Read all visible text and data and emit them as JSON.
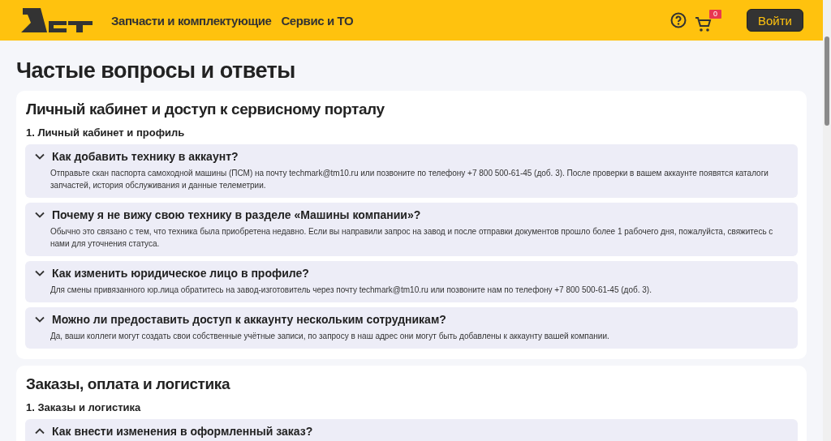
{
  "header": {
    "nav": [
      {
        "label": "Запчасти и комплектующие"
      },
      {
        "label": "Сервис и ТО"
      }
    ],
    "cart_count": "0",
    "login_button": "Войти"
  },
  "title": "Частые вопросы и ответы",
  "sections": [
    {
      "title": "Личный кабинет и доступ к сервисному порталу",
      "subtitle": "1. Личный кабинет и профиль",
      "items": [
        {
          "question": "Как добавить технику в аккаунт?",
          "expanded": true,
          "answer": "Отправьте скан паспорта самоходной машины (ПСМ) на почту techmark@tm10.ru или позвоните по телефону +7 800 500-61-45 (доб. 3). После проверки в вашем аккаунте появятся каталоги запчастей, история обслуживания и данные телеметрии."
        },
        {
          "question": "Почему я не вижу свою технику в разделе «Машины компании»?",
          "expanded": true,
          "answer": "Обычно это связано с тем, что техника была приобретена недавно. Если вы направили запрос на завод и после отправки документов прошло более 1 рабочего дня, пожалуйста, свяжитесь с нами для уточнения статуса."
        },
        {
          "question": "Как изменить юридическое лицо в профиле?",
          "expanded": true,
          "answer": "Для смены привязанного юр.лица обратитесь на завод-изготовитель через почту techmark@tm10.ru или позвоните нам по телефону +7 800 500-61-45 (доб. 3)."
        },
        {
          "question": "Можно ли предоставить доступ к аккаунту нескольким сотрудникам?",
          "expanded": true,
          "answer": "Да, ваши коллеги могут создать свои собственные учётные записи, по запросу в наш адрес они могут быть добавлены к аккаунту вашей компании."
        }
      ]
    },
    {
      "title": "Заказы, оплата и логистика",
      "subtitle": "1. Заказы и логистика",
      "items": [
        {
          "question": "Как внести изменения в оформленный заказ?",
          "expanded": false
        }
      ]
    }
  ]
}
